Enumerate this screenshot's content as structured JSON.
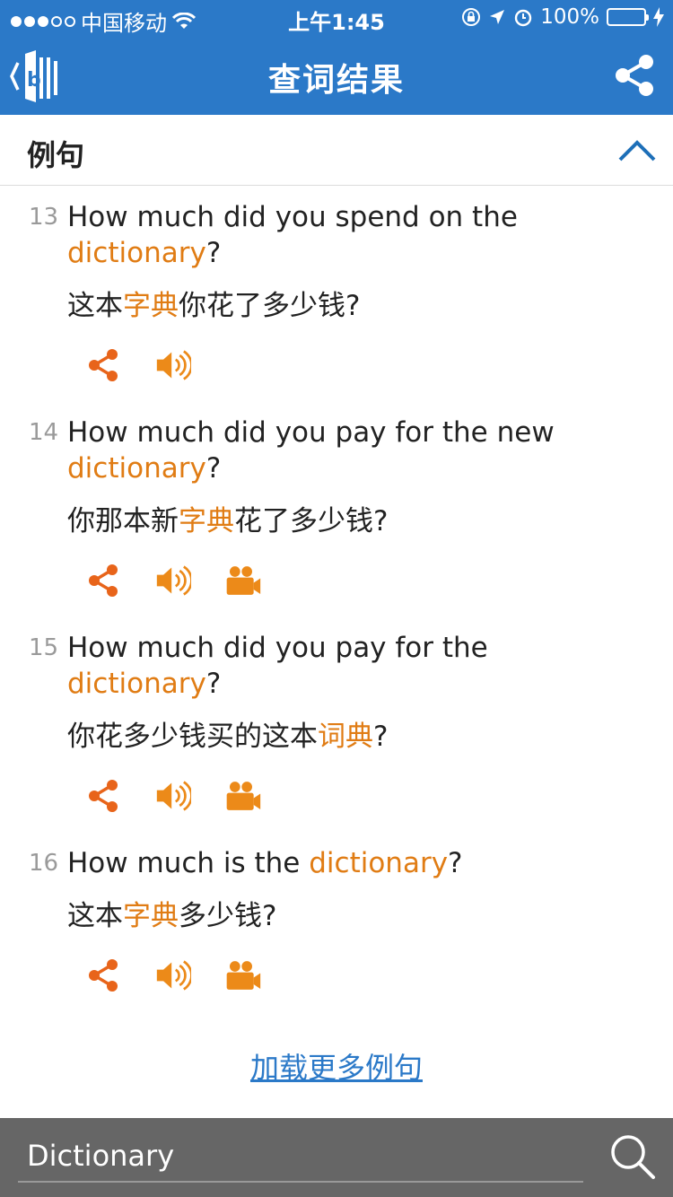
{
  "status_bar": {
    "carrier": "中国移动",
    "time": "上午1:45",
    "battery": "100%",
    "battery_color": "#4cd964"
  },
  "nav": {
    "title": "查词结果",
    "bg_color": "#2b79c8"
  },
  "section": {
    "title": "例句"
  },
  "examples": [
    {
      "num": "13",
      "en_before": "How much did you spend on the ",
      "en_hl": "dictionary",
      "en_after": "?",
      "zh_before": "这本",
      "zh_hl": "字典",
      "zh_after": "你花了多少钱?",
      "has_video": false
    },
    {
      "num": "14",
      "en_before": "How much did you pay for the new ",
      "en_hl": "dictionary",
      "en_after": "?",
      "zh_before": "你那本新",
      "zh_hl": "字典",
      "zh_after": "花了多少钱?",
      "has_video": true
    },
    {
      "num": "15",
      "en_before": "How much did you pay for the ",
      "en_hl": "dictionary",
      "en_after": "?",
      "zh_before": "你花多少钱买的这本",
      "zh_hl": "词典",
      "zh_after": "?",
      "has_video": true
    },
    {
      "num": "16",
      "en_before": "How much is the ",
      "en_hl": "dictionary",
      "en_after": "?",
      "zh_before": "这本",
      "zh_hl": "字典",
      "zh_after": "多少钱?",
      "has_video": true
    }
  ],
  "load_more": "加载更多例句",
  "search": {
    "value": "Dictionary"
  },
  "colors": {
    "accent": "#e07c14",
    "link": "#2b79c8"
  }
}
